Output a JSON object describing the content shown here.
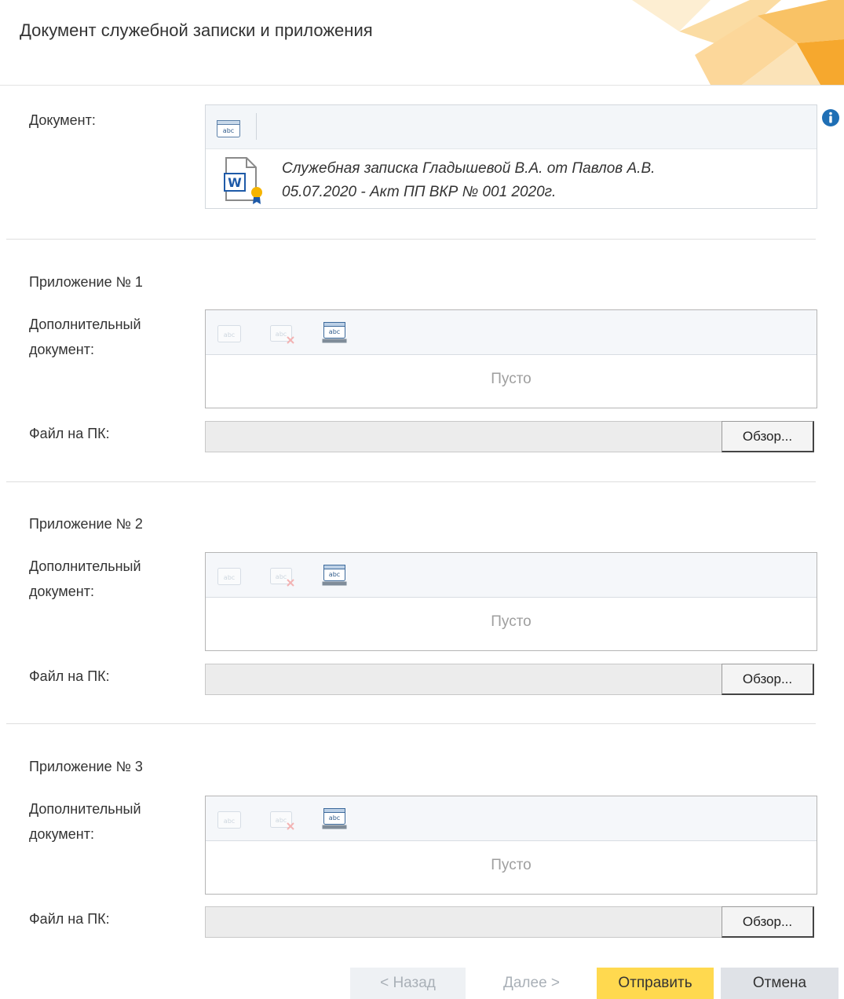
{
  "header": {
    "title": "Документ служебной записки и приложения"
  },
  "document": {
    "label": "Документ:",
    "line1": "Служебная записка Гладышевой В.А. от Павлов А.В.",
    "line2": "05.07.2020 - Акт ПП ВКР № 001 2020г."
  },
  "attachments": [
    {
      "title": "Приложение № 1",
      "doc_label_1": "Дополнительный",
      "doc_label_2": "документ:",
      "empty": "Пусто",
      "file_label": "Файл на ПК:",
      "browse": "Обзор..."
    },
    {
      "title": "Приложение № 2",
      "doc_label_1": "Дополнительный",
      "doc_label_2": "документ:",
      "empty": "Пусто",
      "file_label": "Файл на ПК:",
      "browse": "Обзор..."
    },
    {
      "title": "Приложение № 3",
      "doc_label_1": "Дополнительный",
      "doc_label_2": "документ:",
      "empty": "Пусто",
      "file_label": "Файл на ПК:",
      "browse": "Обзор..."
    }
  ],
  "footer": {
    "back": "< Назад",
    "next": "Далее >",
    "send": "Отправить",
    "cancel": "Отмена"
  },
  "colors": {
    "send_button": "#ffd94f",
    "cancel_button": "#dfe2e7",
    "info_icon": "#1f6fb5",
    "word_icon": "#1e5aa8"
  }
}
